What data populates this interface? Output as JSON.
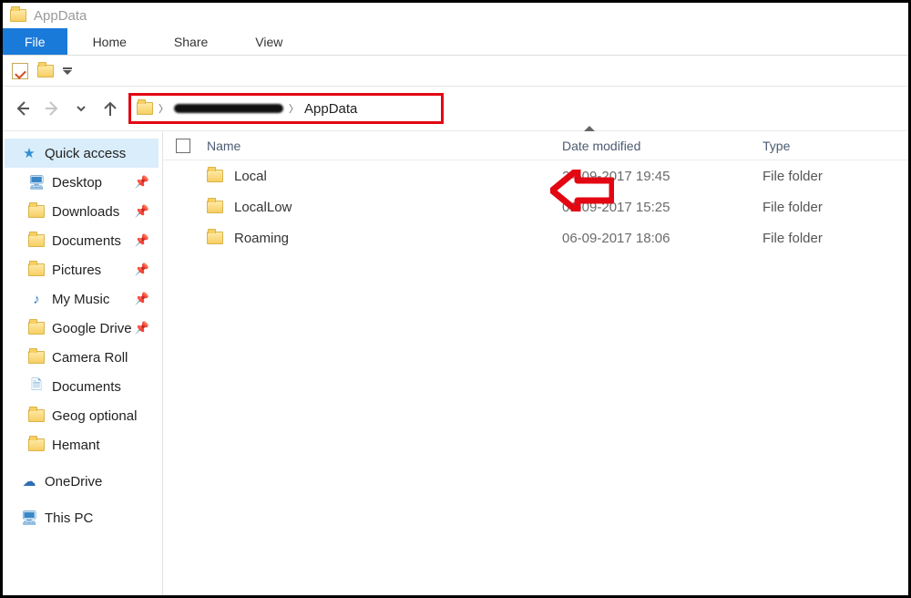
{
  "window": {
    "title": "AppData"
  },
  "tabs": {
    "file": "File",
    "home": "Home",
    "share": "Share",
    "view": "View"
  },
  "breadcrumb": {
    "current": "AppData"
  },
  "columns": {
    "name": "Name",
    "date": "Date modified",
    "type": "Type"
  },
  "sidebar": {
    "quick_access": "Quick access",
    "items": [
      {
        "label": "Desktop",
        "pinned": true,
        "icon": "desktop"
      },
      {
        "label": "Downloads",
        "pinned": true,
        "icon": "folder"
      },
      {
        "label": "Documents",
        "pinned": true,
        "icon": "folder"
      },
      {
        "label": "Pictures",
        "pinned": true,
        "icon": "folder"
      },
      {
        "label": "My Music",
        "pinned": true,
        "icon": "music"
      },
      {
        "label": "Google Drive",
        "pinned": true,
        "icon": "folder"
      },
      {
        "label": "Camera Roll",
        "pinned": false,
        "icon": "folder"
      },
      {
        "label": "Documents",
        "pinned": false,
        "icon": "doc"
      },
      {
        "label": "Geog optional",
        "pinned": false,
        "icon": "folder"
      },
      {
        "label": "Hemant",
        "pinned": false,
        "icon": "folder"
      }
    ],
    "onedrive": "OneDrive",
    "thispc": "This PC"
  },
  "files": [
    {
      "name": "Local",
      "date": "24-09-2017 19:45",
      "type": "File folder"
    },
    {
      "name": "LocalLow",
      "date": "01-09-2017 15:25",
      "type": "File folder"
    },
    {
      "name": "Roaming",
      "date": "06-09-2017 18:06",
      "type": "File folder"
    }
  ]
}
